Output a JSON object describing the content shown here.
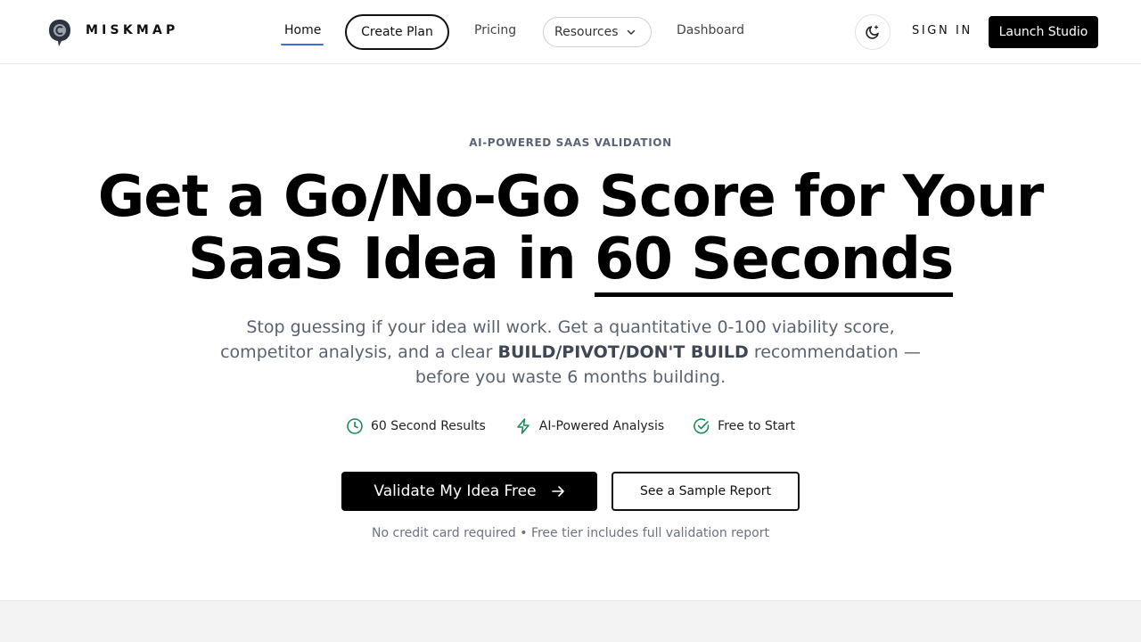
{
  "header": {
    "brand": "MISKMAP",
    "logo_icon": "speech-bubble-logo-icon",
    "nav": {
      "home": "Home",
      "create_plan": "Create Plan",
      "pricing": "Pricing",
      "resources": "Resources",
      "dashboard": "Dashboard"
    },
    "theme_icon": "moon-icon",
    "sign_in": "SIGN IN",
    "launch": "Launch Studio"
  },
  "hero": {
    "eyebrow": "AI-POWERED SAAS VALIDATION",
    "headline_line1": "Get a Go/No-Go Score for Your",
    "headline_line2_prefix": "SaaS Idea in ",
    "headline_line2_highlight": "60 Seconds",
    "sub_part1": "Stop guessing if your idea will work. Get a quantitative 0-100 viability score, competitor analysis, and a clear ",
    "sub_bold": "BUILD/PIVOT/DON'T BUILD",
    "sub_part2": " recommendation —before you waste 6 months building.",
    "features": [
      {
        "icon": "clock-icon",
        "label": "60 Second Results"
      },
      {
        "icon": "lightning-icon",
        "label": "AI-Powered Analysis"
      },
      {
        "icon": "check-circle-icon",
        "label": "Free to Start"
      }
    ],
    "cta_primary": "Validate My Idea Free",
    "cta_secondary": "See a Sample Report",
    "note": "No credit card required • Free tier includes full validation report"
  },
  "colors": {
    "accent_green": "#1f8a5c",
    "nav_underline": "#3b6fd1",
    "primary": "#000000"
  }
}
